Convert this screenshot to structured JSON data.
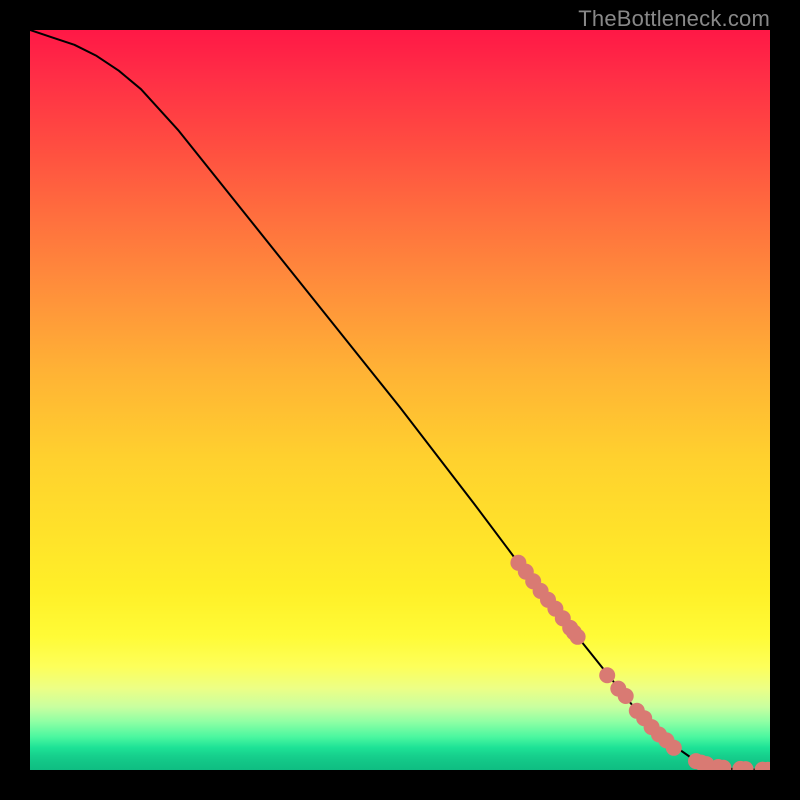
{
  "attribution": "TheBottleneck.com",
  "chart_data": {
    "type": "line",
    "title": "",
    "xlabel": "",
    "ylabel": "",
    "xlim": [
      0,
      100
    ],
    "ylim": [
      0,
      100
    ],
    "series": [
      {
        "name": "curve",
        "x": [
          0,
          3,
          6,
          9,
          12,
          15,
          20,
          30,
          40,
          50,
          60,
          66,
          70,
          74,
          78,
          82,
          86,
          90,
          92,
          94,
          96,
          98,
          100
        ],
        "y": [
          100,
          99,
          98,
          96.5,
          94.5,
          92,
          86.5,
          74,
          61.5,
          49,
          36,
          28,
          23,
          18,
          13,
          8,
          4,
          1.2,
          0.5,
          0.2,
          0.1,
          0.05,
          0
        ]
      }
    ],
    "markers": [
      {
        "name": "cluster-upper",
        "x": [
          66,
          67,
          68,
          69,
          70,
          71,
          72,
          73,
          73.5,
          74
        ],
        "y": [
          28,
          26.8,
          25.5,
          24.2,
          23,
          21.8,
          20.5,
          19.2,
          18.6,
          18
        ]
      },
      {
        "name": "cluster-mid",
        "x": [
          78,
          79.5,
          80.5,
          82,
          83,
          84
        ],
        "y": [
          12.8,
          11,
          10,
          8,
          7,
          5.8
        ]
      },
      {
        "name": "cluster-gap1",
        "x": [
          85
        ],
        "y": [
          4.8
        ]
      },
      {
        "name": "cluster-lower",
        "x": [
          86,
          87
        ],
        "y": [
          4,
          3
        ]
      },
      {
        "name": "flat-cluster",
        "x": [
          90,
          90.7,
          91.4,
          93,
          93.7,
          96,
          96.7,
          99,
          99.7
        ],
        "y": [
          1.2,
          1.0,
          0.8,
          0.4,
          0.3,
          0.15,
          0.12,
          0.05,
          0.04
        ]
      }
    ],
    "marker_color": "#d97a73",
    "curve_color": "#000000"
  }
}
